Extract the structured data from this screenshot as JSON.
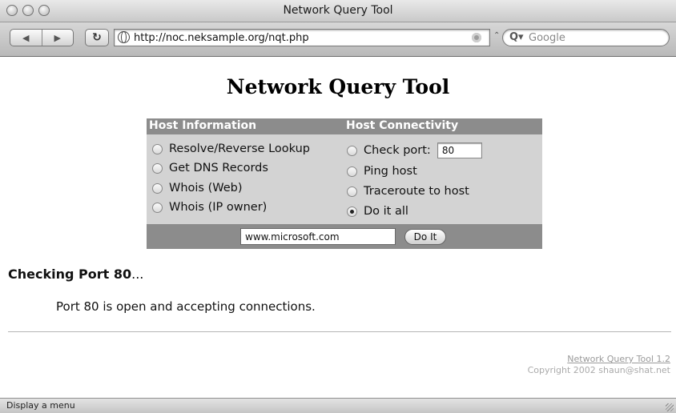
{
  "window": {
    "title": "Network Query Tool"
  },
  "toolbar": {
    "back_glyph": "◀",
    "forward_glyph": "▶",
    "reload_glyph": "↻",
    "url": "http://noc.neksample.org/nqt.php",
    "search_placeholder": "Google",
    "search_glyph": "Q▾"
  },
  "page": {
    "title": "Network Query Tool",
    "form": {
      "host_information_heading": "Host Information",
      "host_connectivity_heading": "Host Connectivity",
      "left_options": [
        {
          "label": "Resolve/Reverse Lookup",
          "selected": false
        },
        {
          "label": "Get DNS Records",
          "selected": false
        },
        {
          "label": "Whois (Web)",
          "selected": false
        },
        {
          "label": "Whois (IP owner)",
          "selected": false
        }
      ],
      "right_options": [
        {
          "label": "Check port:",
          "selected": false
        },
        {
          "label": "Ping host",
          "selected": false
        },
        {
          "label": "Traceroute to host",
          "selected": false
        },
        {
          "label": "Do it all",
          "selected": true
        }
      ],
      "port_value": "80",
      "host_value": "www.microsoft.com",
      "submit_label": "Do It"
    },
    "result": {
      "heading_bold": "Checking Port 80",
      "heading_suffix": "...",
      "message": "Port 80 is open and accepting connections."
    },
    "footer": {
      "link": "Network Query Tool 1.2",
      "copyright": "Copyright 2002 shaun@shat.net"
    }
  },
  "statusbar": {
    "text": "Display a menu"
  },
  "colors": {
    "table_bg": "#d3d3d3",
    "table_header": "#8c8c8c"
  }
}
